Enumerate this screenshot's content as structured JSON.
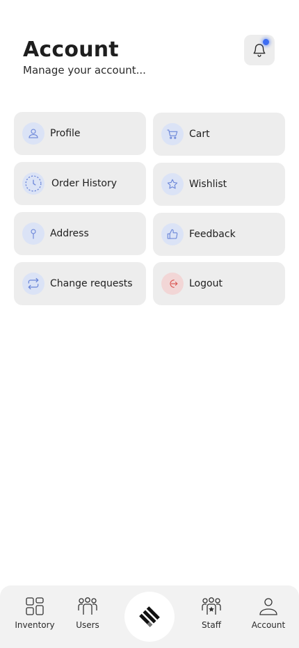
{
  "header": {
    "title": "Account",
    "subtitle": "Manage your account...",
    "notification_icon": "bell-icon",
    "notification_dot_color": "#3e6df2"
  },
  "menu": {
    "items": [
      {
        "label": "Profile",
        "icon": "user-icon"
      },
      {
        "label": "Cart",
        "icon": "cart-icon"
      },
      {
        "label": "Order History",
        "icon": "clock-icon"
      },
      {
        "label": "Wishlist",
        "icon": "star-icon"
      },
      {
        "label": "Address",
        "icon": "map-pin-icon"
      },
      {
        "label": "Feedback",
        "icon": "thumbs-up-icon"
      },
      {
        "label": "Change requests",
        "icon": "repeat-icon"
      },
      {
        "label": "Logout",
        "icon": "logout-icon"
      }
    ],
    "accent_color": "#6b86d8",
    "danger_color": "#d9534f"
  },
  "bottom_nav": {
    "items": [
      {
        "label": "Inventory",
        "icon": "grid-icon"
      },
      {
        "label": "Users",
        "icon": "users-icon"
      },
      {
        "label": "",
        "icon": "logo-icon"
      },
      {
        "label": "Staff",
        "icon": "staff-icon"
      },
      {
        "label": "Account",
        "icon": "user-icon"
      }
    ]
  }
}
